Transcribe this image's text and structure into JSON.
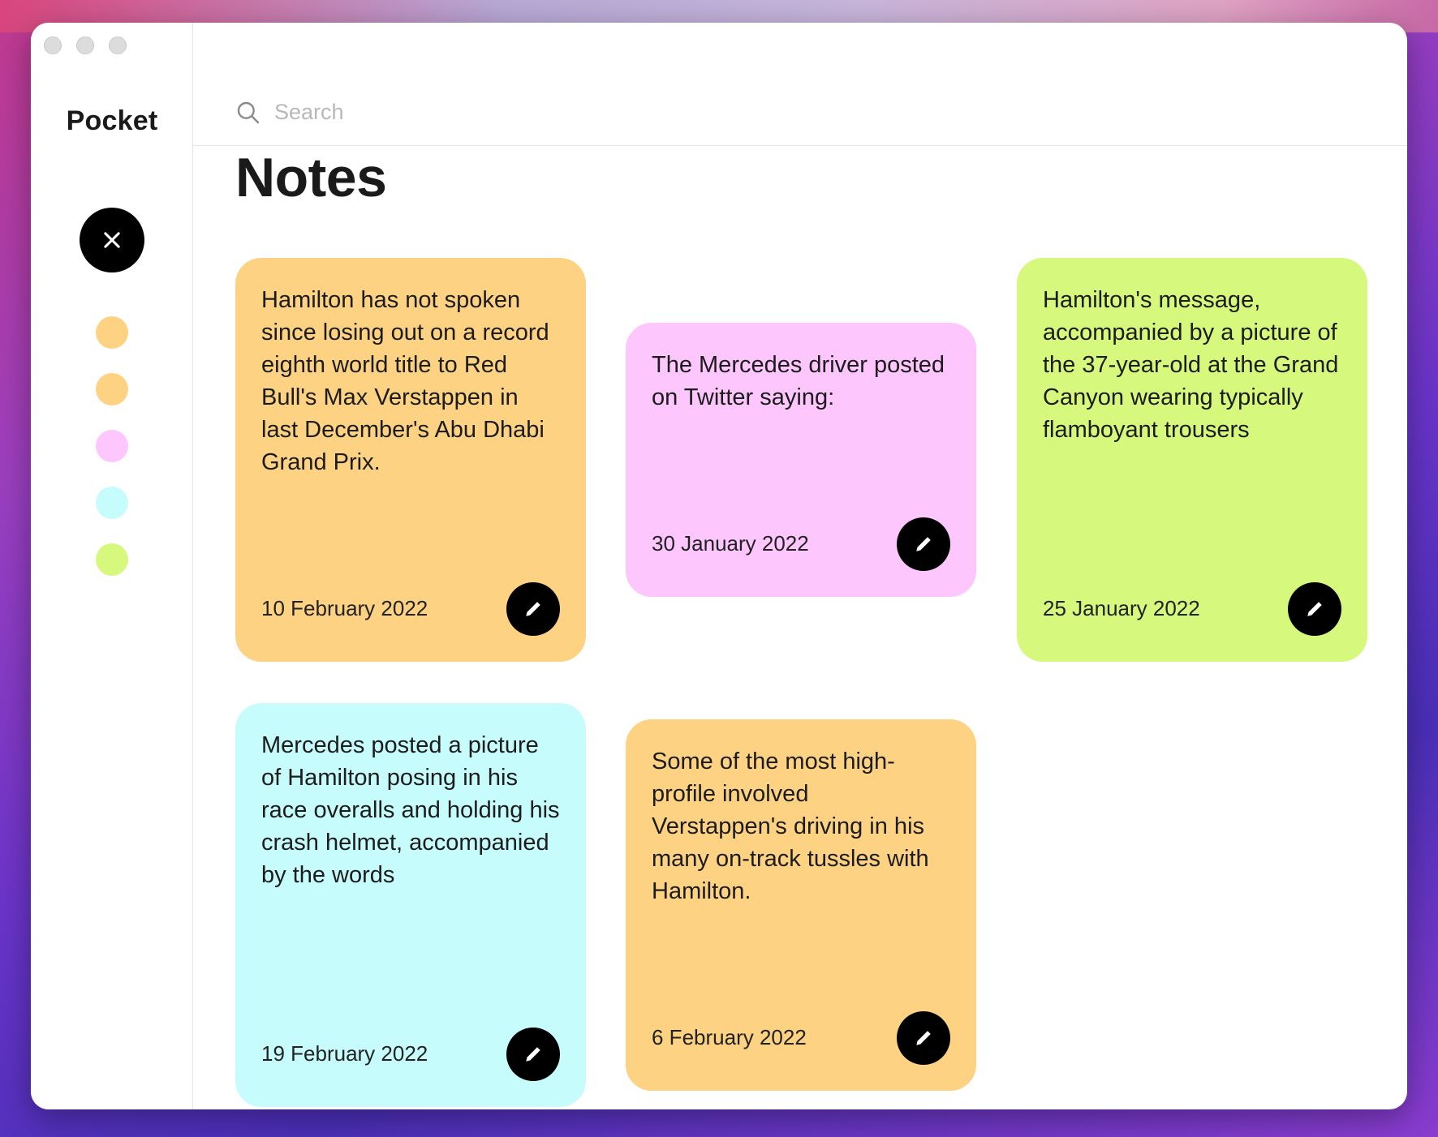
{
  "sidebar": {
    "brand": "Pocket",
    "close_icon": "close-icon",
    "swatches": [
      {
        "color": "#fdd282"
      },
      {
        "color": "#fdd282"
      },
      {
        "color": "#fdc6fd"
      },
      {
        "color": "#c6fcfc"
      },
      {
        "color": "#d6f87d"
      }
    ]
  },
  "search": {
    "placeholder": "Search",
    "icon": "search-icon"
  },
  "main": {
    "title": "Notes"
  },
  "notes": [
    {
      "text": "Hamilton has not spoken since losing out on a record eighth world title to Red Bull's Max Verstappen in last December's Abu Dhabi Grand Prix.",
      "date": "10 February 2022",
      "color": "#fdd282"
    },
    {
      "text": "The Mercedes driver posted on Twitter saying:",
      "date": "30 January 2022",
      "color": "#fdc6fd"
    },
    {
      "text": "Hamilton's message, accompanied by a picture of the 37-year-old at the Grand Canyon wearing typically flamboyant trousers",
      "date": "25 January 2022",
      "color": "#d6f87d"
    },
    {
      "text": "Mercedes posted a picture of Hamilton posing in his race overalls and holding his crash helmet, accompanied by the words",
      "date": "19 February 2022",
      "color": "#c6fcfc"
    },
    {
      "text": "Some of the most high-profile involved Verstappen's driving in his many on-track tussles with Hamilton.",
      "date": "6 February 2022",
      "color": "#fdd282"
    }
  ]
}
